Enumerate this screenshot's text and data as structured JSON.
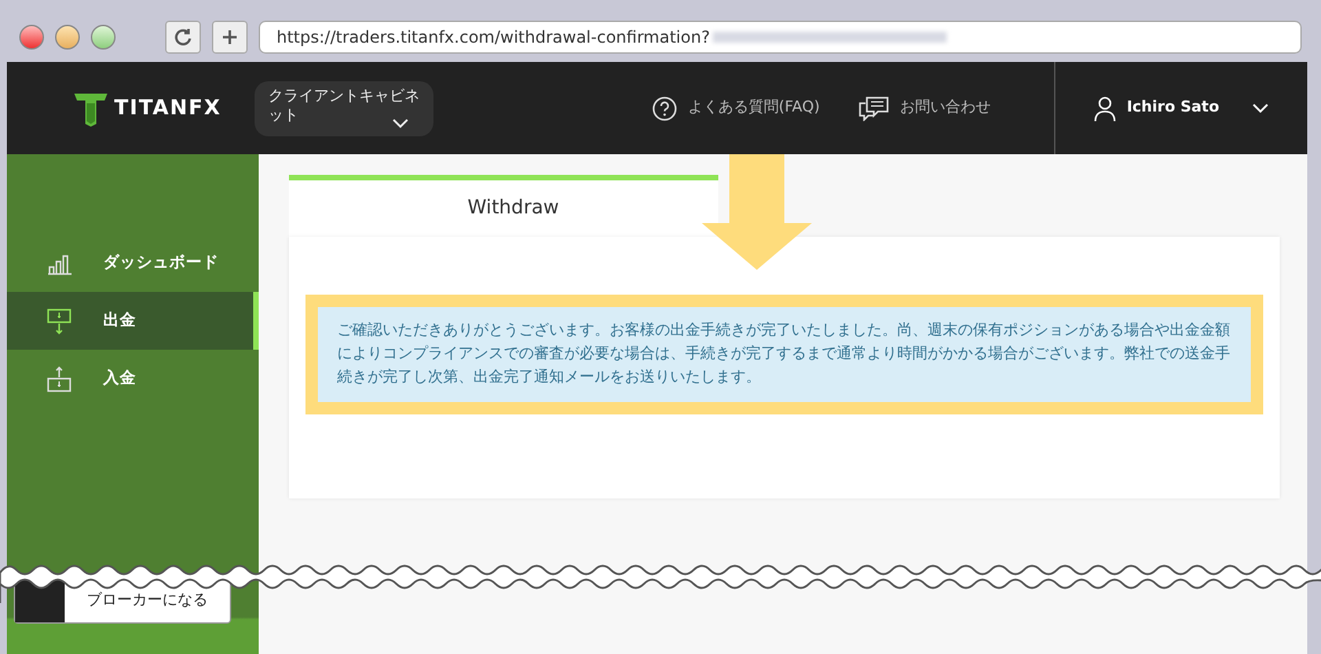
{
  "browser": {
    "url": "https://traders.titanfx.com/withdrawal-confirmation?"
  },
  "header": {
    "logo": "TITANFX",
    "cabinet_menu": "クライアントキャビネット",
    "faq": "よくある質問(FAQ)",
    "contact": "お問い合わせ",
    "user": "Ichiro Sato"
  },
  "sidebar": {
    "items": [
      {
        "label": "ダッシュボード",
        "kind": "dashboard",
        "selected": false
      },
      {
        "label": "出金",
        "kind": "withdraw",
        "selected": true
      },
      {
        "label": "入金",
        "kind": "deposit",
        "selected": false
      }
    ],
    "broker_button": "ブローカーになる"
  },
  "tab": {
    "label": "Withdraw"
  },
  "alert": "ご確認いただきありがとうございます。お客様の出金手続きが完了いたしました。尚、週末の保有ポジションがある場合や出金金額によりコンプライアンスでの審査が必要な場合は、手続きが完了するまで通常より時間がかかる場合がございます。弊社での送金手続きが完了し次第、出金完了通知メールをお送りいたします。"
}
